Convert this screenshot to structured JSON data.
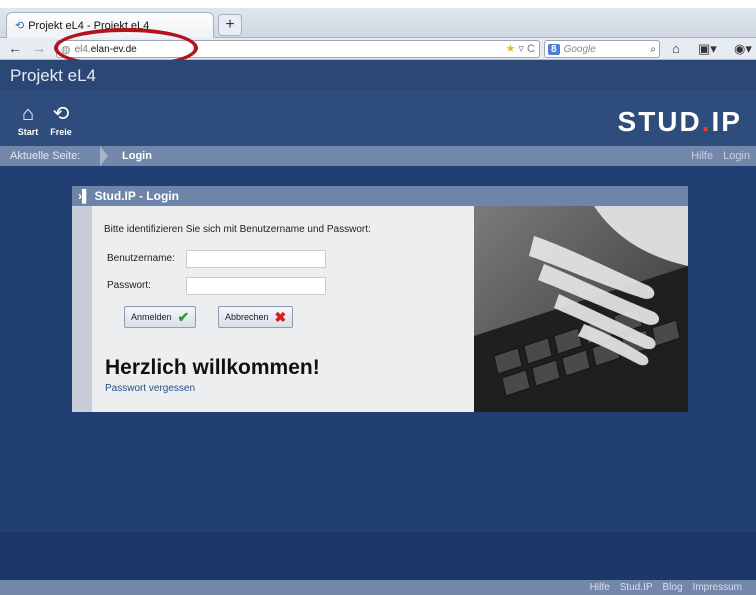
{
  "browser": {
    "tab_title": "Projekt eL4 - Projekt eL4",
    "new_tab": "+",
    "url_prefix": "el4.",
    "url_host": "elan-ev.de",
    "search_placeholder": "Google"
  },
  "site": {
    "title": "Projekt eL4",
    "nav": [
      {
        "label": "Start",
        "icon": "home-icon"
      },
      {
        "label": "Freie",
        "icon": "free-icon"
      }
    ],
    "logo": "STUD",
    "logo_dot": ".",
    "logo_suffix": "IP"
  },
  "breadcrumb": {
    "label": "Aktuelle Seite:",
    "current": "Login",
    "help": "Hilfe",
    "login": "Login"
  },
  "login_box": {
    "title": "Stud.IP - Login",
    "intro": "Bitte identifizieren Sie sich mit Benutzername und Passwort:",
    "username_label": "Benutzername:",
    "password_label": "Passwort:",
    "submit_label": "Anmelden",
    "cancel_label": "Abbrechen",
    "welcome": "Herzlich willkommen!",
    "forgot": "Passwort vergessen"
  },
  "footer": {
    "links": [
      "Hilfe",
      "Stud.IP",
      "Blog",
      "Impressum"
    ]
  },
  "colors": {
    "header": "#2b4775",
    "main": "#213f73",
    "breadcrumb": "#7387ab",
    "annotation": "#b3131b"
  }
}
